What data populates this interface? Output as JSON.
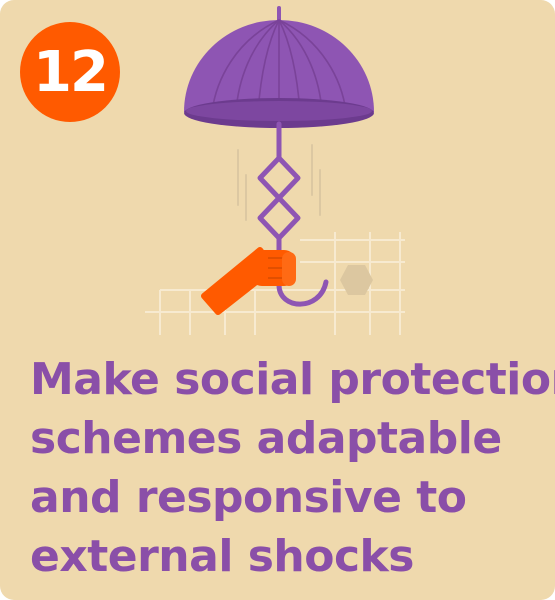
{
  "card": {
    "number": "12",
    "headline_lines": [
      "Make social protection",
      "schemes adaptable",
      "and responsive to",
      "external shocks"
    ]
  },
  "colors": {
    "background": "#efd9ad",
    "badge": "#ff5a00",
    "headline": "#8a4fa8",
    "umbrella": "#8e55b3",
    "hand": "#ff5a00"
  },
  "icons": {
    "illustration": "umbrella-held-by-hand-icon",
    "decoration": "hexagon-icon"
  }
}
